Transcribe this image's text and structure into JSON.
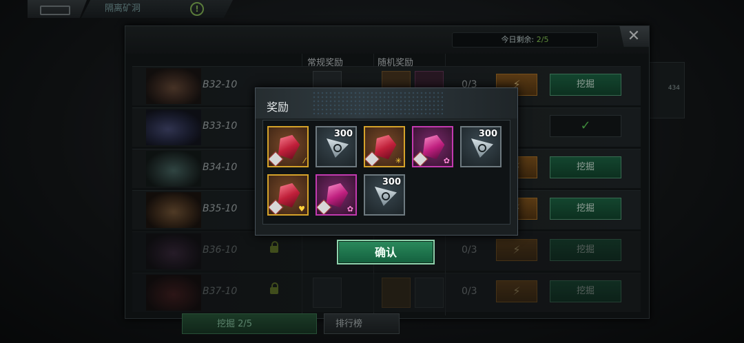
{
  "header": {
    "title": "隔离矿洞",
    "info_icon": "info-icon",
    "back_icon": "back-icon"
  },
  "panel": {
    "remaining_label": "今日剩余:",
    "remaining_value": "2/5",
    "close_label": "✕",
    "col_regular": "常规奖励",
    "col_random": "随机奖励",
    "rows": [
      {
        "code": "B32-10",
        "count": "0/3",
        "bolt": "⚡",
        "action": "挖掘",
        "state": "open"
      },
      {
        "code": "B33-10",
        "count": "",
        "bolt": "",
        "action": "✓",
        "state": "done"
      },
      {
        "code": "B34-10",
        "count": "",
        "bolt": "⚡",
        "action": "挖掘",
        "state": "open"
      },
      {
        "code": "B35-10",
        "count": "",
        "bolt": "⚡",
        "action": "挖掘",
        "state": "open"
      },
      {
        "code": "B36-10",
        "count": "0/3",
        "bolt": "⚡",
        "action": "挖掘",
        "state": "locked"
      },
      {
        "code": "B37-10",
        "count": "0/3",
        "bolt": "⚡",
        "action": "挖掘",
        "state": "locked"
      }
    ],
    "side_number": "434"
  },
  "bottom": {
    "dig_label": "挖掘 2/5",
    "rank_label": "排行榜"
  },
  "popup": {
    "title": "奖励",
    "items": [
      {
        "kind": "gem",
        "rarity": "gold",
        "qty": "",
        "sub": "⁄"
      },
      {
        "kind": "triangle",
        "rarity": "silver",
        "qty": "300",
        "sub": ""
      },
      {
        "kind": "gem",
        "rarity": "gold",
        "qty": "",
        "sub": "✳"
      },
      {
        "kind": "gem",
        "rarity": "purple",
        "qty": "",
        "sub": "✿"
      },
      {
        "kind": "triangle",
        "rarity": "silver",
        "qty": "300",
        "sub": ""
      },
      {
        "kind": "gem",
        "rarity": "gold",
        "qty": "",
        "sub": "♥"
      },
      {
        "kind": "gem",
        "rarity": "purple",
        "qty": "",
        "sub": "✿"
      },
      {
        "kind": "triangle",
        "rarity": "silver",
        "qty": "300",
        "sub": ""
      }
    ],
    "confirm_label": "确认"
  },
  "colors": {
    "accent_green": "#8fd35a",
    "gold": "#d6a32a",
    "purple": "#c33ab0"
  }
}
